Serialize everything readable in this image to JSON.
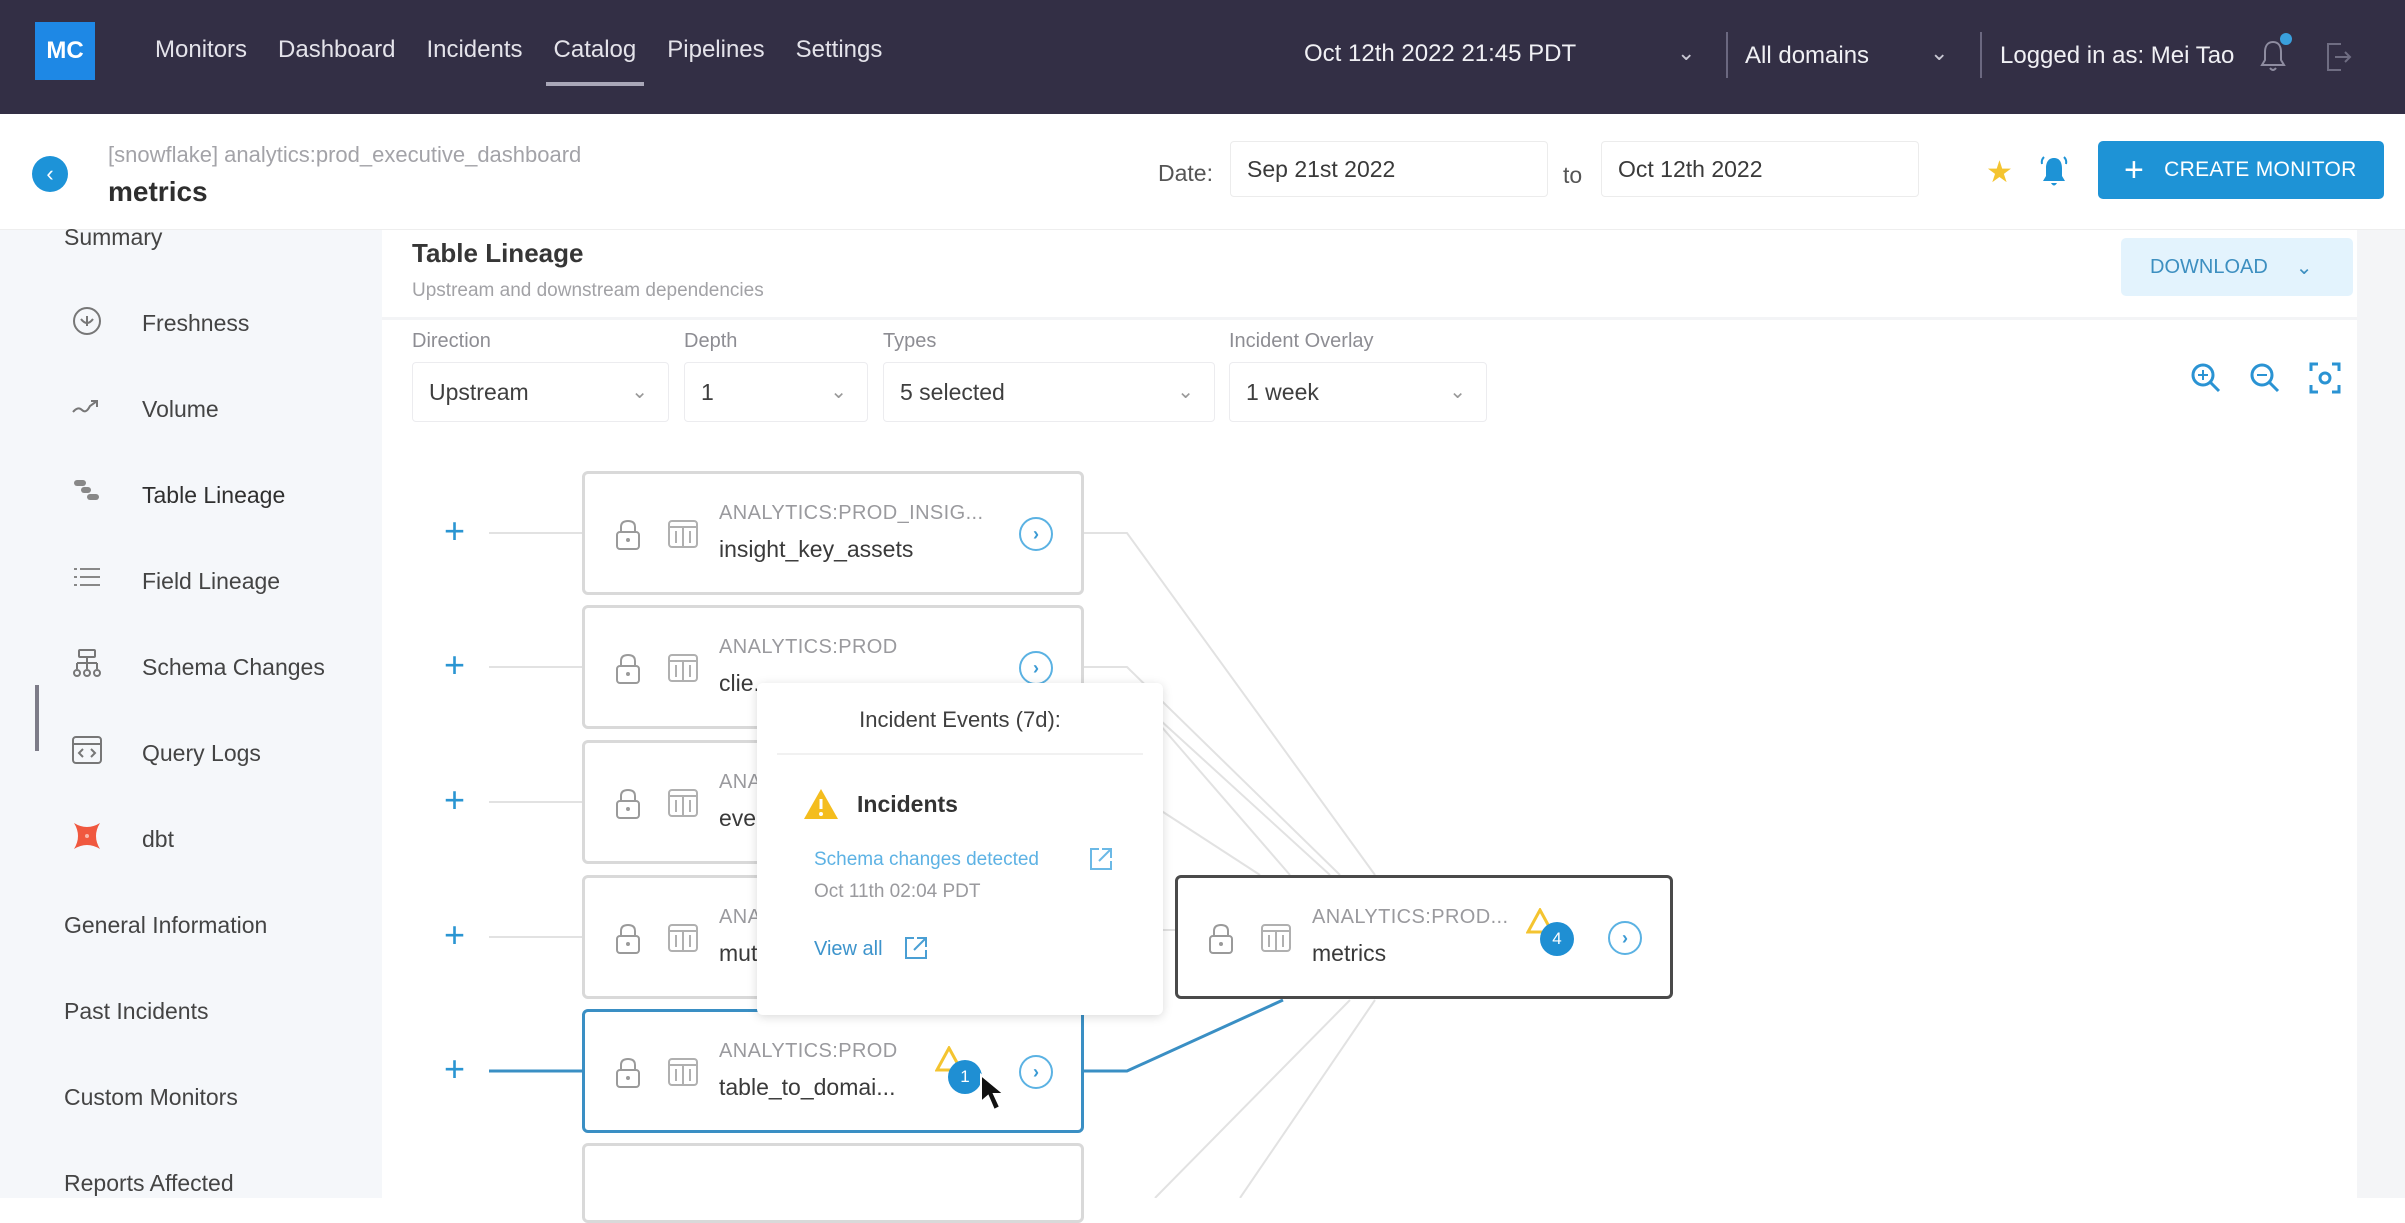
{
  "topbar": {
    "logo": "MC",
    "nav": [
      {
        "label": "Monitors",
        "active": false
      },
      {
        "label": "Dashboard",
        "active": false
      },
      {
        "label": "Incidents",
        "active": false
      },
      {
        "label": "Catalog",
        "active": true
      },
      {
        "label": "Pipelines",
        "active": false
      },
      {
        "label": "Settings",
        "active": false
      }
    ],
    "datetime": "Oct 12th 2022 21:45 PDT",
    "domain": "All domains",
    "user": "Logged in as: Mei Tao",
    "icons": {
      "notifications": "bell-icon",
      "logout": "logout-icon"
    }
  },
  "header": {
    "breadcrumb": "[snowflake] analytics:prod_executive_dashboard",
    "title": "metrics",
    "date_label": "Date:",
    "date_from": "Sep 21st 2022",
    "to_label": "to",
    "date_to": "Oct 12th 2022",
    "create_monitor": "CREATE MONITOR"
  },
  "sidebar": {
    "summary": "Summary",
    "items": [
      {
        "label": "Freshness",
        "icon": "freshness-icon"
      },
      {
        "label": "Volume",
        "icon": "volume-icon"
      },
      {
        "label": "Table Lineage",
        "icon": "table-lineage-icon",
        "active": true
      },
      {
        "label": "Field Lineage",
        "icon": "field-lineage-icon"
      },
      {
        "label": "Schema Changes",
        "icon": "schema-changes-icon"
      },
      {
        "label": "Query Logs",
        "icon": "query-logs-icon"
      },
      {
        "label": "dbt",
        "icon": "dbt-icon"
      }
    ],
    "sections": [
      "General Information",
      "Past Incidents",
      "Custom Monitors",
      "Reports Affected"
    ]
  },
  "lineage": {
    "title": "Table Lineage",
    "subtitle": "Upstream and downstream dependencies",
    "download": "DOWNLOAD",
    "filters": [
      {
        "label": "Direction",
        "value": "Upstream"
      },
      {
        "label": "Depth",
        "value": "1"
      },
      {
        "label": "Types",
        "value": "5 selected"
      },
      {
        "label": "Incident Overlay",
        "value": "1 week"
      }
    ],
    "nodes": [
      {
        "db": "ANALYTICS:PROD_INSIG...",
        "name": "insight_key_assets"
      },
      {
        "db": "ANALYTICS:PROD",
        "name": "clie..."
      },
      {
        "db": "ANA...",
        "name": "eve..."
      },
      {
        "db": "ANA...",
        "name": "mut..."
      },
      {
        "db": "ANALYTICS:PROD",
        "name": "table_to_domai...",
        "incidents": "1",
        "selected": true
      }
    ],
    "focus_node": {
      "db": "ANALYTICS:PROD...",
      "name": "metrics",
      "incidents": "4"
    },
    "popover": {
      "title": "Incident Events (7d):",
      "section": "Incidents",
      "event": "Schema changes detected",
      "event_time": "Oct 11th 02:04 PDT",
      "view_all": "View all"
    }
  },
  "colors": {
    "topbar": "#332f45",
    "accent": "#1e93d6",
    "warning": "#f4c430",
    "dbt": "#f0583f"
  }
}
